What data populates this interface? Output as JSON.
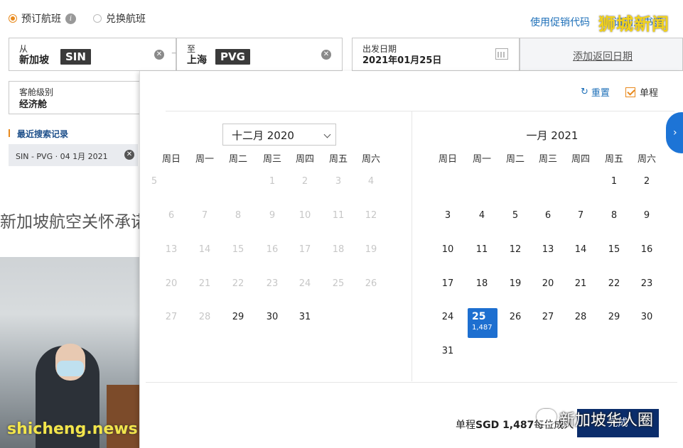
{
  "trip_type": {
    "book": "预订航班",
    "redeem": "兑换航班"
  },
  "promo": "使用促销代码",
  "watermark_top": "狮城新闻",
  "watermark_top_behind": "请加入书签",
  "from": {
    "label": "从",
    "city": "新加坡",
    "code": "SIN"
  },
  "to": {
    "label": "至",
    "city": "上海",
    "code": "PVG"
  },
  "depart": {
    "label": "出发日期",
    "value": "2021年01月25日"
  },
  "return_link": "添加返回日期",
  "cabin": {
    "label": "客舱级别",
    "value": "经济舱"
  },
  "recent": {
    "title": "最近搜索记录",
    "item": "SIN - PVG · 04 1月 2021"
  },
  "hero_title": "新加坡航空关怀承诺",
  "watermark_left": "shicheng.news",
  "calendar": {
    "reset": "重置",
    "oneway": "单程",
    "left_month": "十二月 2020",
    "right_month": "一月 2021",
    "weekdays": [
      "周日",
      "周一",
      "周二",
      "周三",
      "周四",
      "周五",
      "周六"
    ],
    "dec_days": [
      [
        "",
        "1",
        "2",
        "3",
        "4",
        "5"
      ],
      [
        "6",
        "7",
        "8",
        "9",
        "10",
        "11",
        "12"
      ],
      [
        "13",
        "14",
        "15",
        "16",
        "17",
        "18",
        "19"
      ],
      [
        "20",
        "21",
        "22",
        "23",
        "24",
        "25",
        "26"
      ],
      [
        "27",
        "28",
        "29",
        "30",
        "31"
      ]
    ],
    "jan_days": [
      [
        "1",
        "2"
      ],
      [
        "3",
        "4",
        "5",
        "6",
        "7",
        "8",
        "9"
      ],
      [
        "10",
        "11",
        "12",
        "13",
        "14",
        "15",
        "16"
      ],
      [
        "17",
        "18",
        "19",
        "20",
        "21",
        "22",
        "23"
      ],
      [
        "24",
        "25",
        "26",
        "27",
        "28",
        "29",
        "30"
      ],
      [
        "31"
      ]
    ],
    "selected_day": "25",
    "selected_price": "1,487",
    "footer_prefix": "单程",
    "footer_price": "SGD 1,487",
    "footer_suffix": "每位成人",
    "done": "完成",
    "watermark_br": "新加坡华人圈"
  }
}
